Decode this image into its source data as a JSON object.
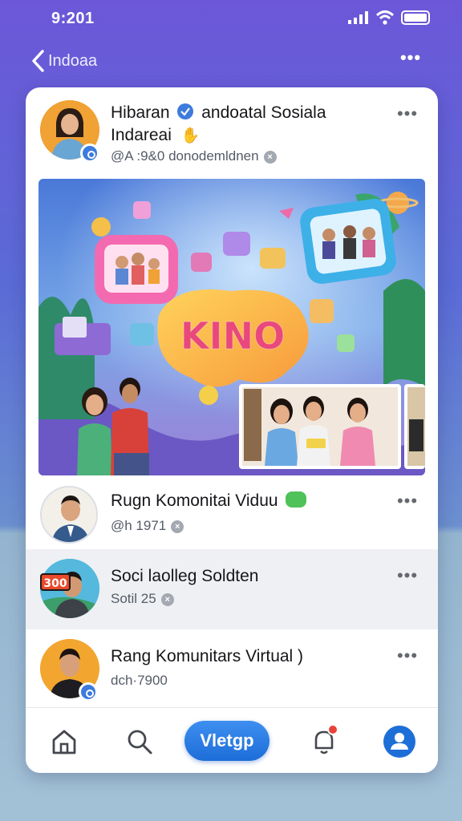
{
  "status_bar": {
    "time": "9:201"
  },
  "nav": {
    "back_label": "Indoaa"
  },
  "post": {
    "title": "Hibaran",
    "title_rest": "andoatal Sosiala",
    "title_line2": "Indareai",
    "meta": "@A :9&0 donodemldnen",
    "hero_word": "KINO"
  },
  "list": [
    {
      "name": "Rugn Komonitai Viduu",
      "meta": "@h 1971"
    },
    {
      "name": "Soci laolleg Soldten",
      "meta": "Sotil 25",
      "badge": "300"
    },
    {
      "name": "Rang Komunitars Virtual )",
      "meta": "dch·7900"
    }
  ],
  "bottom_nav": {
    "primary_label": "Vletgp"
  },
  "colors": {
    "accent": "#1d6dd8",
    "notification": "#e8433a",
    "card": "#ffffff"
  },
  "icons": [
    "back-chevron-icon",
    "more-icon",
    "verified-icon",
    "home-icon",
    "search-icon",
    "bell-icon",
    "profile-icon"
  ]
}
